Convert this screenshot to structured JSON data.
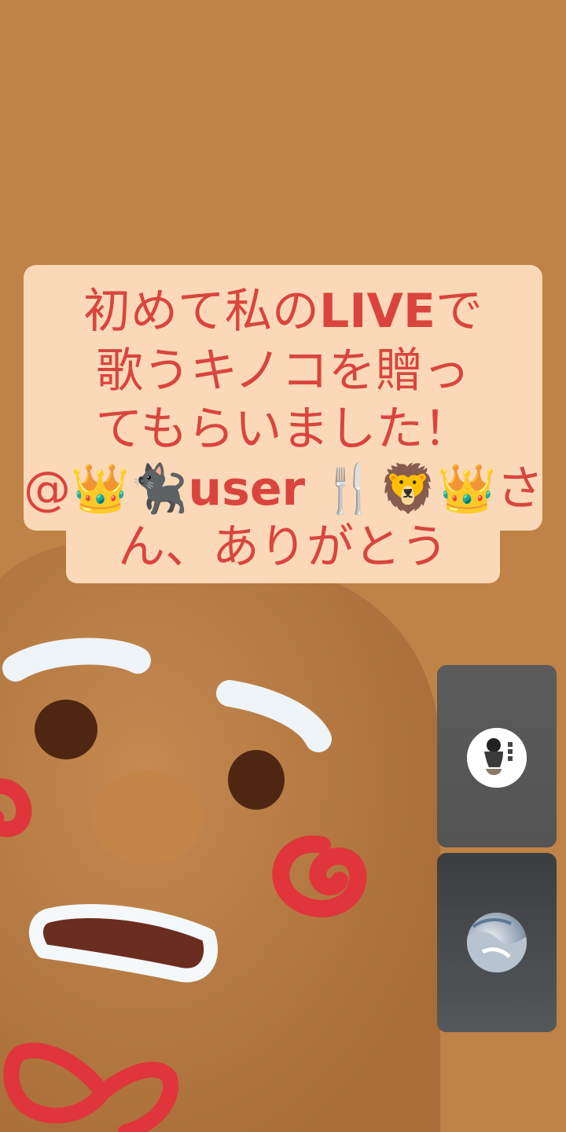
{
  "caption": {
    "lines": [
      {
        "pre": "初めて私の",
        "bold": "LIVE",
        "post": "で"
      },
      {
        "pre": "歌うキノコを贈っ",
        "bold": "",
        "post": ""
      },
      {
        "pre": "てもらいました！",
        "bold": "",
        "post": ""
      },
      {
        "pre": "@👑🐈‍⬛",
        "bold": "user",
        "post": " 🍴🦁👑さ"
      },
      {
        "pre": "ん、ありがとう",
        "bold": "",
        "post": ""
      }
    ],
    "text_color": "#d9453d",
    "background_color": "#fbd9b8"
  },
  "participants": [
    {
      "avatar": "avatar-icon"
    },
    {
      "avatar": "avatar-icon"
    }
  ],
  "colors": {
    "background": "#bf8247",
    "cookie": "#b77a43",
    "icing_white": "#ffffff",
    "icing_red": "#e0353a"
  }
}
